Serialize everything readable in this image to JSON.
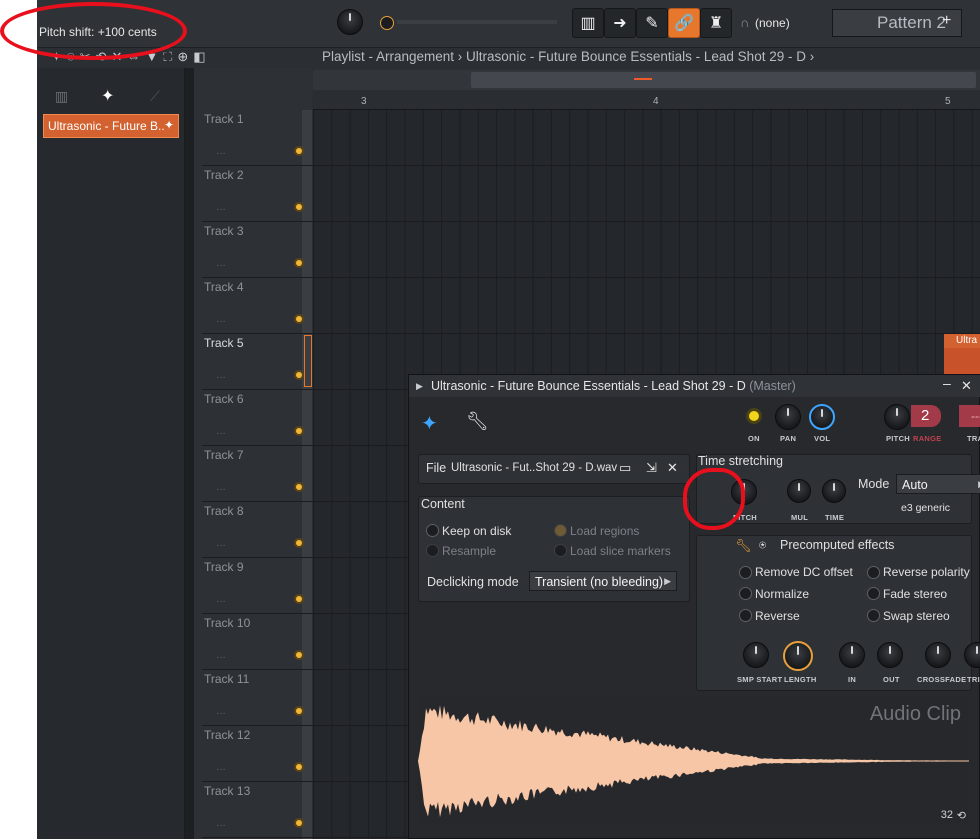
{
  "topbar": {
    "hint": "Pitch shift: +100 cents",
    "none_label": "(none)",
    "pattern": "Pattern 2"
  },
  "breadcrumb": {
    "text": "Playlist - Arrangement › Ultrasonic - Future Bounce Essentials - Lead Shot 29 - D ›"
  },
  "browser": {
    "clip": "Ultrasonic - Future B.."
  },
  "ruler": {
    "marks": [
      "3",
      "4",
      "5"
    ]
  },
  "tracks": [
    "Track 1",
    "Track 2",
    "Track 3",
    "Track 4",
    "Track 5",
    "Track 6",
    "Track 7",
    "Track 8",
    "Track 9",
    "Track 10",
    "Track 11",
    "Track 12",
    "Track 13"
  ],
  "playlist_clip": {
    "label": "Ultra"
  },
  "plugin": {
    "title": "Ultrasonic - Future Bounce Essentials - Lead Shot 29 - D",
    "master": "(Master)",
    "top_knobs": {
      "on": "ON",
      "pan": "PAN",
      "vol": "VOL",
      "pitch": "PITCH",
      "range": "RANGE",
      "range_value": "2",
      "track": "TRACK",
      "track_value": "---"
    },
    "file": {
      "label": "File",
      "name": "Ultrasonic - Fut..Shot 29 - D.wav"
    },
    "content": {
      "header": "Content",
      "keep": "Keep on disk",
      "resample": "Resample",
      "load_regions": "Load regions",
      "load_slices": "Load slice markers",
      "declick_label": "Declicking mode",
      "declick_value": "Transient (no bleeding)"
    },
    "time": {
      "header": "Time stretching",
      "pitch": "PITCH",
      "mul": "MUL",
      "time": "TIME",
      "mode_label": "Mode",
      "mode_value": "Auto",
      "mode_sub": "e3 generic"
    },
    "precomputed": {
      "header": "Precomputed effects",
      "remove_dc": "Remove DC offset",
      "normalize": "Normalize",
      "reverse": "Reverse",
      "reverse_polarity": "Reverse polarity",
      "fade_stereo": "Fade stereo",
      "swap_stereo": "Swap stereo"
    },
    "bottom_knobs": [
      "SMP START",
      "LENGTH",
      "IN",
      "OUT",
      "CROSSFADE",
      "TRIM"
    ],
    "wave_label": "Audio Clip",
    "zoom": "32"
  }
}
